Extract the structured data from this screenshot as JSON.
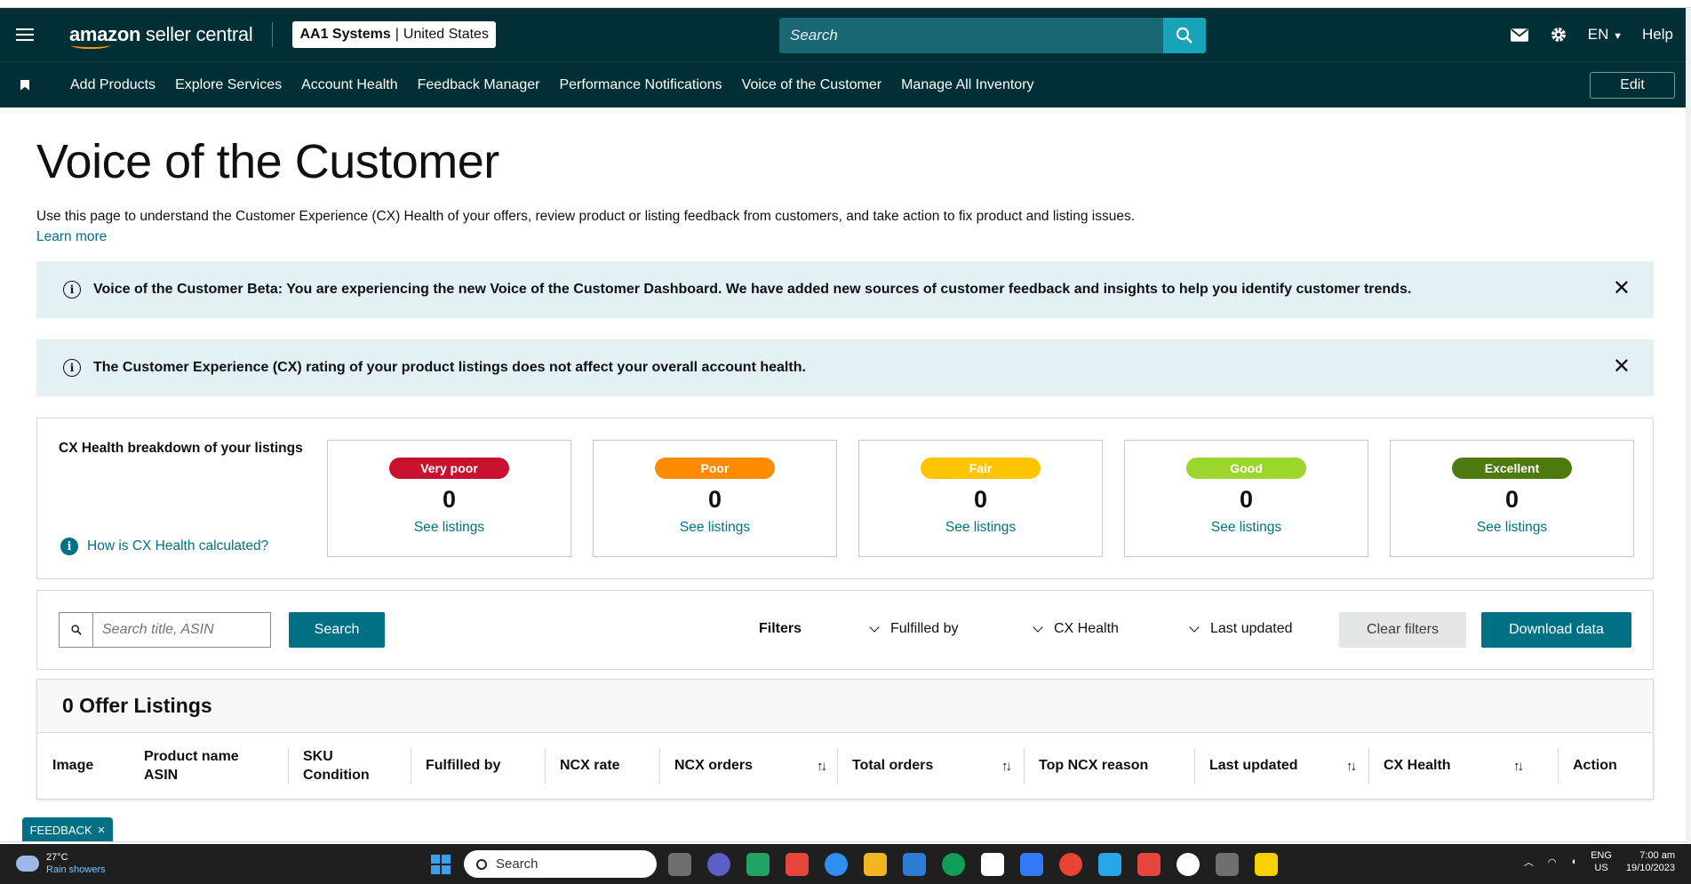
{
  "header": {
    "logo_main": "amazon",
    "logo_sub": "seller central",
    "account_name": "AA1 Systems",
    "account_sep": "|",
    "account_region": "United States",
    "search_placeholder": "Search",
    "language": "EN",
    "help_label": "Help"
  },
  "subnav": {
    "items": [
      "Add Products",
      "Explore Services",
      "Account Health",
      "Feedback Manager",
      "Performance Notifications",
      "Voice of the Customer",
      "Manage All Inventory"
    ],
    "edit_label": "Edit"
  },
  "page": {
    "title": "Voice of the Customer",
    "intro": "Use this page to understand the Customer Experience (CX) Health of your offers, review product or listing feedback from customers, and take action to fix product and listing issues.",
    "learn_more": "Learn more"
  },
  "alerts": [
    {
      "text": "Voice of the Customer Beta: You are experiencing the new Voice of the Customer Dashboard. We have added new sources of customer feedback and insights to help you identify customer trends."
    },
    {
      "text": "The Customer Experience (CX) rating of your product listings does not affect your overall account health."
    }
  ],
  "cx_health": {
    "title": "CX Health breakdown of your listings",
    "help_link": "How is CX Health calculated?",
    "cards": [
      {
        "label": "Very poor",
        "count": "0",
        "link": "See listings",
        "color": "#c7112e"
      },
      {
        "label": "Poor",
        "count": "0",
        "link": "See listings",
        "color": "#ff8c00"
      },
      {
        "label": "Fair",
        "count": "0",
        "link": "See listings",
        "color": "#ffc400"
      },
      {
        "label": "Good",
        "count": "0",
        "link": "See listings",
        "color": "#9cd62d"
      },
      {
        "label": "Excellent",
        "count": "0",
        "link": "See listings",
        "color": "#4d7a0f"
      }
    ]
  },
  "filters": {
    "search_placeholder": "Search title, ASIN",
    "search_button": "Search",
    "filters_label": "Filters",
    "dropdowns": [
      "Fulfilled by",
      "CX Health",
      "Last updated"
    ],
    "clear_button": "Clear filters",
    "download_button": "Download data"
  },
  "table": {
    "title": "0 Offer Listings",
    "columns": {
      "image": "Image",
      "product_name": "Product name",
      "asin": "ASIN",
      "sku": "SKU",
      "condition": "Condition",
      "fulfilled_by": "Fulfilled by",
      "ncx_rate": "NCX rate",
      "ncx_orders": "NCX orders",
      "total_orders": "Total orders",
      "top_ncx_reason": "Top NCX reason",
      "last_updated": "Last updated",
      "cx_health": "CX Health",
      "action": "Action"
    }
  },
  "feedback_tab": {
    "label": "FEEDBACK",
    "close": "×"
  },
  "taskbar": {
    "temp": "27°C",
    "weather": "Rain showers",
    "search": "Search",
    "lang_top": "ENG",
    "lang_bottom": "US",
    "time": "7:00 am",
    "date": "19/10/2023",
    "icon_colors": [
      "#6f6f6f",
      "#5b5fc7",
      "#21a366",
      "#e8453c",
      "#2f8ff0",
      "#f2b622",
      "#2b7cd3",
      "#0f9d58",
      "#ffffff",
      "#3378f6",
      "#ea4335",
      "#27a7e7",
      "#e8453c",
      "#ffffff",
      "#6f6f6f",
      "#f7d000"
    ]
  }
}
